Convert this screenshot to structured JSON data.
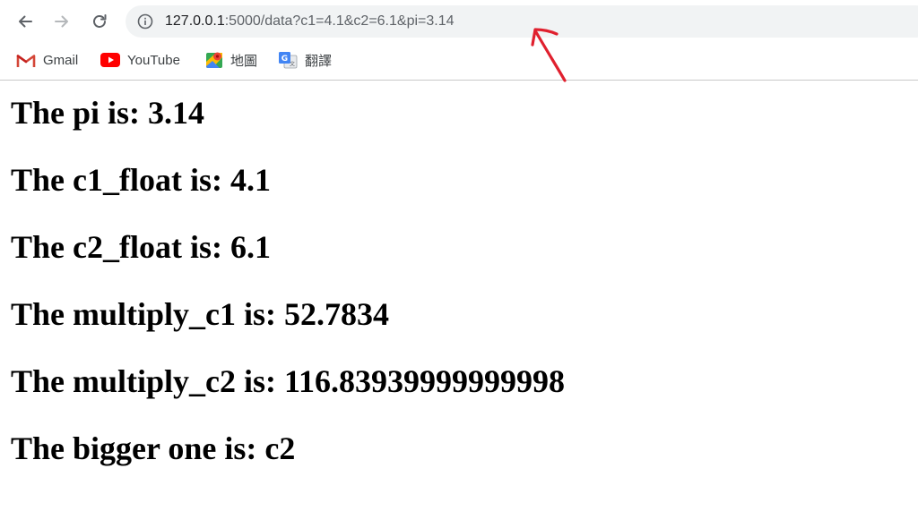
{
  "toolbar": {
    "url_host": "127.0.0.1",
    "url_rest": ":5000/data?c1=4.1&c2=6.1&pi=3.14"
  },
  "bookmarks": [
    {
      "label": "Gmail",
      "icon": "gmail-icon"
    },
    {
      "label": "YouTube",
      "icon": "youtube-icon"
    },
    {
      "label": "地圖",
      "icon": "maps-icon"
    },
    {
      "label": "翻譯",
      "icon": "translate-icon"
    }
  ],
  "annotation": {
    "color": "#e0202e",
    "icon": "red-arrow-icon"
  },
  "content": {
    "lines": [
      "The pi is: 3.14",
      "The c1_float is: 4.1",
      "The c2_float is: 6.1",
      "The multiply_c1 is: 52.7834",
      "The multiply_c2 is: 116.83939999999998",
      "The bigger one is: c2"
    ]
  }
}
